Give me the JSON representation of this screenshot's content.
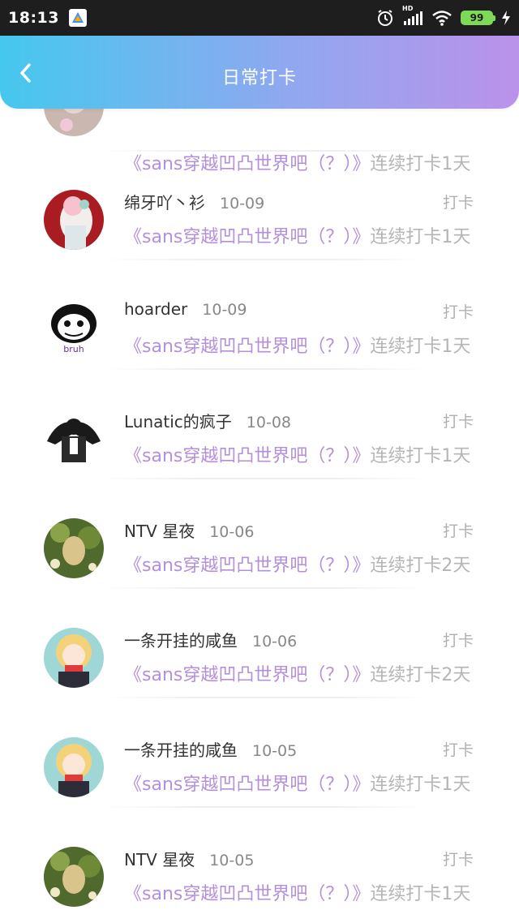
{
  "status_bar": {
    "time": "18:13",
    "network_label": "HD",
    "battery": "99",
    "icons": [
      "alarm-icon",
      "signal-icon",
      "wifi-icon",
      "battery-icon",
      "lightning-icon"
    ]
  },
  "header": {
    "title": "日常打卡",
    "back_icon": "chevron-left-icon",
    "gradient": [
      "#45c8ee",
      "#bb92ea"
    ]
  },
  "colors": {
    "topic": "#b48fdc",
    "muted": "#b5b5b5",
    "name": "#333333"
  },
  "partial_item": {
    "topic": "《sans穿越凹凸世界吧（？）》",
    "streak": "连续打卡1天"
  },
  "items": [
    {
      "name": "绵牙吖丶衫",
      "date": "10-09",
      "action": "打卡",
      "topic": "《sans穿越凹凸世界吧（？）》",
      "streak": "连续打卡1天"
    },
    {
      "name": "hoarder",
      "date": "10-09",
      "action": "打卡",
      "topic": "《sans穿越凹凸世界吧（？）》",
      "streak": "连续打卡1天",
      "avatar_text": "bruh"
    },
    {
      "name": "Lunatic的疯子",
      "date": "10-08",
      "action": "打卡",
      "topic": "《sans穿越凹凸世界吧（？）》",
      "streak": "连续打卡1天"
    },
    {
      "name": "NTV 星夜",
      "date": "10-06",
      "action": "打卡",
      "topic": "《sans穿越凹凸世界吧（？）》",
      "streak": "连续打卡2天"
    },
    {
      "name": "一条开挂的咸鱼",
      "date": "10-06",
      "action": "打卡",
      "topic": "《sans穿越凹凸世界吧（？）》",
      "streak": "连续打卡2天"
    },
    {
      "name": "一条开挂的咸鱼",
      "date": "10-05",
      "action": "打卡",
      "topic": "《sans穿越凹凸世界吧（？）》",
      "streak": "连续打卡1天"
    },
    {
      "name": "NTV 星夜",
      "date": "10-05",
      "action": "打卡",
      "topic": "《sans穿越凹凸世界吧（？）》",
      "streak": "连续打卡1天"
    }
  ]
}
